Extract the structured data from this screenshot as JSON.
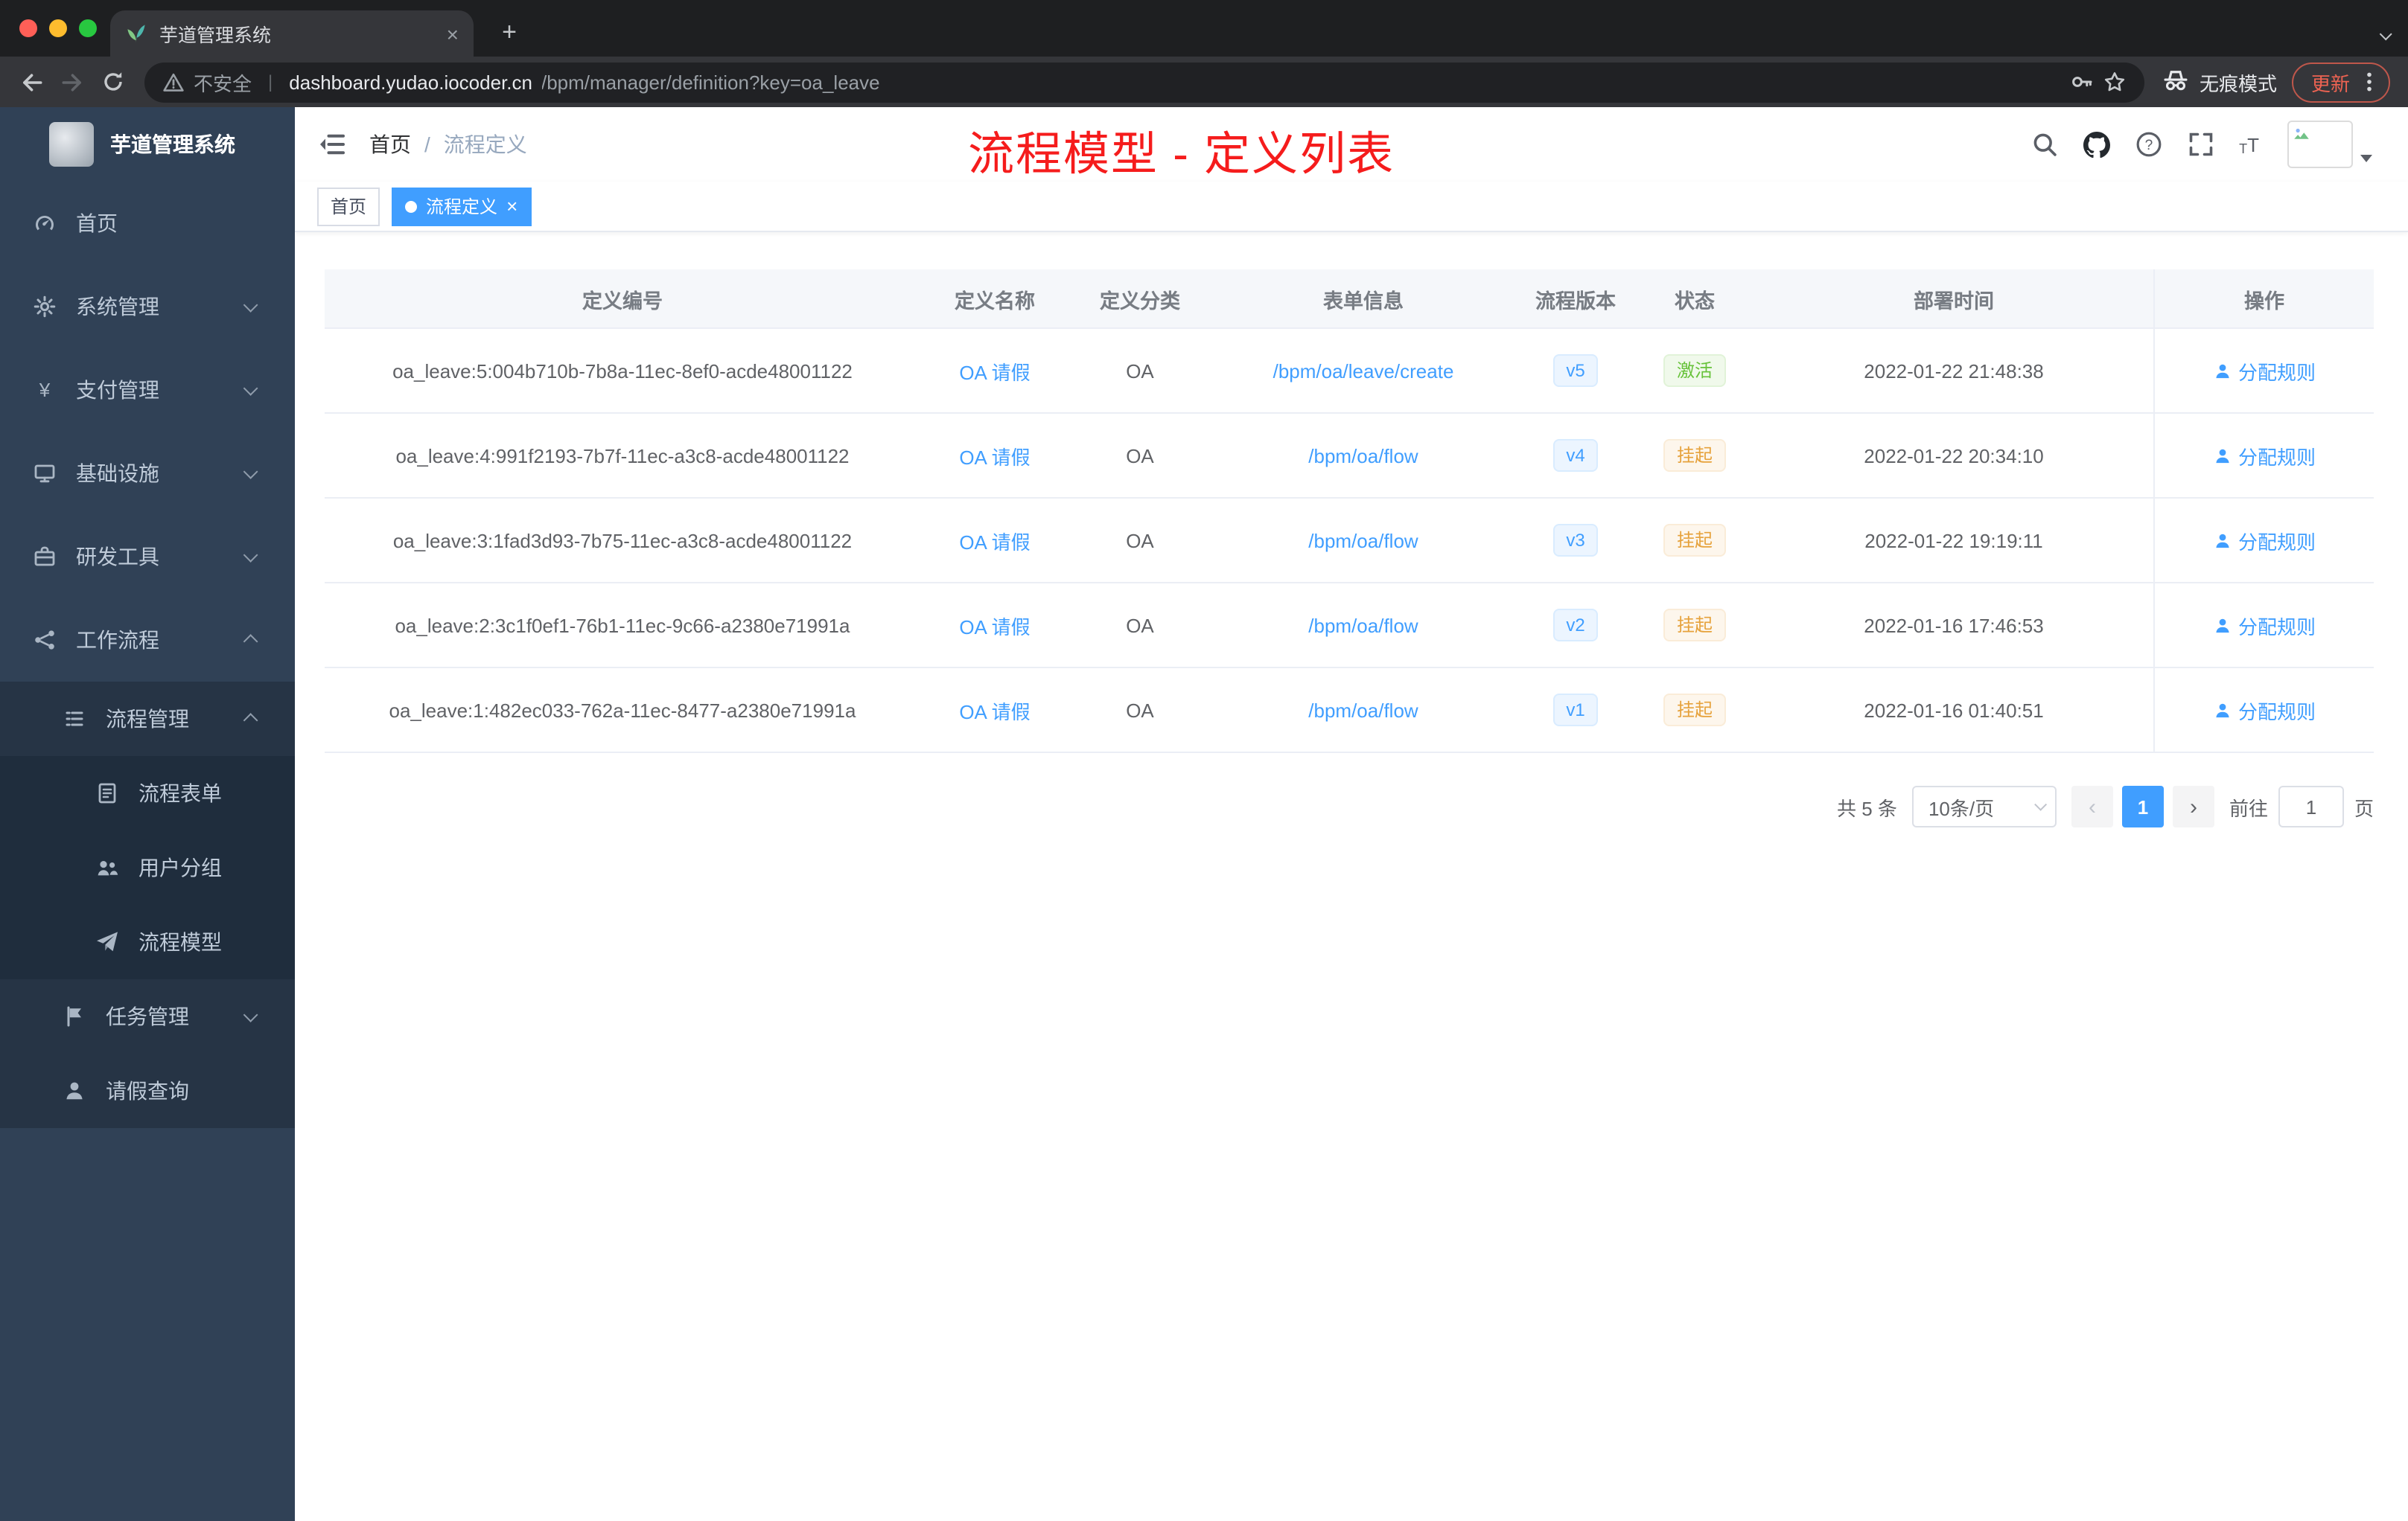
{
  "browser": {
    "tab_title": "芋道管理系统",
    "security_label": "不安全",
    "url_host": "dashboard.yudao.iocoder.cn",
    "url_path": "/bpm/manager/definition?key=oa_leave",
    "incognito_label": "无痕模式",
    "update_label": "更新"
  },
  "icons": {
    "close": "×",
    "plus": "+",
    "more": "⋮",
    "prev": "‹",
    "next": "›",
    "url_separator": "|"
  },
  "sidebar": {
    "logo_title": "芋道管理系统",
    "items": [
      {
        "label": "首页",
        "icon": "dashboard-icon"
      },
      {
        "label": "系统管理",
        "icon": "gear-icon"
      },
      {
        "label": "支付管理",
        "icon": "yen-icon"
      },
      {
        "label": "基础设施",
        "icon": "monitor-icon"
      },
      {
        "label": "研发工具",
        "icon": "toolbox-icon"
      },
      {
        "label": "工作流程",
        "icon": "workflow-icon"
      },
      {
        "label": "流程管理",
        "icon": "list-icon"
      },
      {
        "label": "流程表单",
        "icon": "document-icon"
      },
      {
        "label": "用户分组",
        "icon": "users-icon"
      },
      {
        "label": "流程模型",
        "icon": "paper-plane-icon"
      },
      {
        "label": "任务管理",
        "icon": "flag-icon"
      },
      {
        "label": "请假查询",
        "icon": "user-icon"
      }
    ]
  },
  "header": {
    "breadcrumb": {
      "home": "首页",
      "separator": "/",
      "current": "流程定义"
    },
    "annotation": "流程模型 - 定义列表"
  },
  "tags": {
    "items": [
      {
        "label": "首页"
      },
      {
        "label": "流程定义"
      }
    ]
  },
  "table": {
    "columns": [
      "定义编号",
      "定义名称",
      "定义分类",
      "表单信息",
      "流程版本",
      "状态",
      "部署时间",
      "操作"
    ],
    "rows": [
      {
        "id": "oa_leave:5:004b710b-7b8a-11ec-8ef0-acde48001122",
        "name": "OA 请假",
        "category": "OA",
        "form": "/bpm/oa/leave/create",
        "version": "v5",
        "status": "激活",
        "time": "2022-01-22 21:48:38",
        "action": "分配规则"
      },
      {
        "id": "oa_leave:4:991f2193-7b7f-11ec-a3c8-acde48001122",
        "name": "OA 请假",
        "category": "OA",
        "form": "/bpm/oa/flow",
        "version": "v4",
        "status": "挂起",
        "time": "2022-01-22 20:34:10",
        "action": "分配规则"
      },
      {
        "id": "oa_leave:3:1fad3d93-7b75-11ec-a3c8-acde48001122",
        "name": "OA 请假",
        "category": "OA",
        "form": "/bpm/oa/flow",
        "version": "v3",
        "status": "挂起",
        "time": "2022-01-22 19:19:11",
        "action": "分配规则"
      },
      {
        "id": "oa_leave:2:3c1f0ef1-76b1-11ec-9c66-a2380e71991a",
        "name": "OA 请假",
        "category": "OA",
        "form": "/bpm/oa/flow",
        "version": "v2",
        "status": "挂起",
        "time": "2022-01-16 17:46:53",
        "action": "分配规则"
      },
      {
        "id": "oa_leave:1:482ec033-762a-11ec-8477-a2380e71991a",
        "name": "OA 请假",
        "category": "OA",
        "form": "/bpm/oa/flow",
        "version": "v1",
        "status": "挂起",
        "time": "2022-01-16 01:40:51",
        "action": "分配规则"
      }
    ]
  },
  "pagination": {
    "total": "共 5 条",
    "page_size": "10条/页",
    "current": "1",
    "goto_label": "前往",
    "goto_value": "1",
    "page_unit": "页"
  },
  "colors": {
    "accent": "#409eff",
    "success": "#67c23a",
    "warning": "#e6a23c",
    "annotation": "#f51c1c",
    "sidebar": "#304156"
  }
}
